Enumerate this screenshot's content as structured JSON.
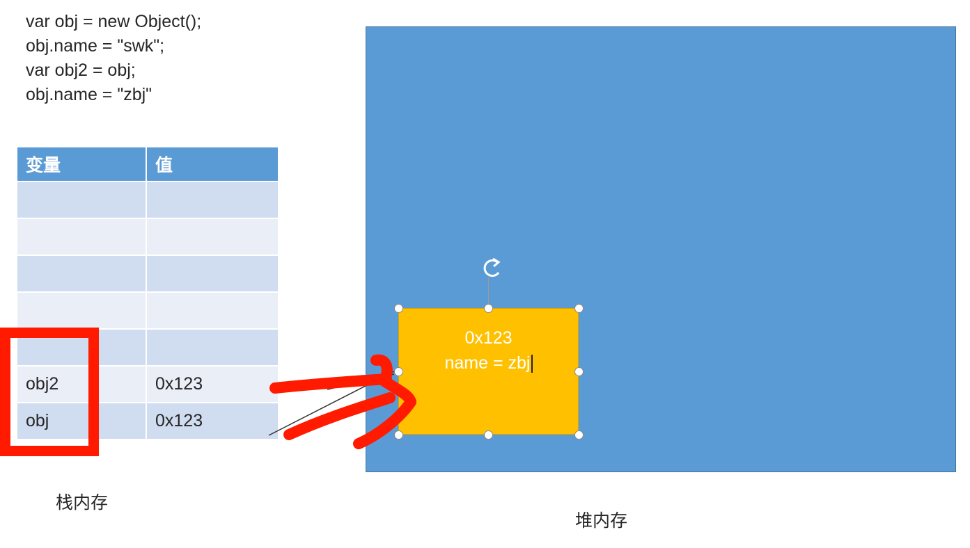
{
  "code_lines": [
    "var obj = new Object();",
    "obj.name = \"swk\";",
    "var obj2 = obj;",
    "obj.name = \"zbj\""
  ],
  "stack": {
    "headers": [
      "变量",
      "值"
    ],
    "rows": [
      [
        "",
        ""
      ],
      [
        "",
        ""
      ],
      [
        "",
        ""
      ],
      [
        "",
        ""
      ],
      [
        "",
        ""
      ],
      [
        "obj2",
        "0x123"
      ],
      [
        "obj",
        "0x123"
      ]
    ],
    "caption": "栈内存"
  },
  "heap": {
    "caption": "堆内存",
    "object": {
      "address": "0x123",
      "property": "name = zbj"
    }
  },
  "colors": {
    "header": "#5b9bd5",
    "heap": "#5b9bd5",
    "object": "#ffc000",
    "annotation": "#ff1a00"
  },
  "icons": [
    "rotate-handle-icon",
    "arrow-annotation"
  ]
}
